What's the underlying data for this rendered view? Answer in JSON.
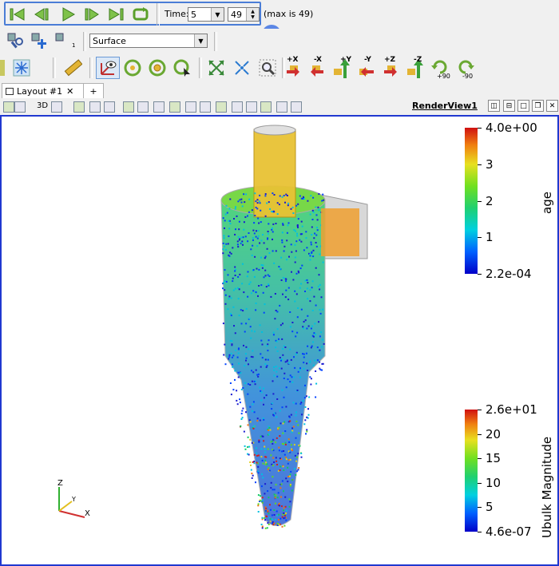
{
  "toolbar_time": {
    "time_label": "Time:",
    "time_value": "5",
    "index_value": "49",
    "max_text": "(max is 49)",
    "badge": "1"
  },
  "toolbar_representation": {
    "value": "Surface",
    "step_label": "1"
  },
  "camera": {
    "plus_x": "+X",
    "minus_x": "-X",
    "plus_y": "+Y",
    "minus_y": "-Y",
    "plus_z": "+Z",
    "minus_z": "-Z",
    "rot_pos": "+90",
    "rot_neg": "-90"
  },
  "tabs": {
    "layout": "Layout #1",
    "add": "+"
  },
  "viewbar": {
    "mode_3d": "3D",
    "render_view": "RenderView1"
  },
  "colorbar_age": {
    "title": "age",
    "ticks": [
      "4.0e+00",
      "3",
      "2",
      "1",
      "2.2e-04"
    ],
    "range": [
      0.00022,
      4.0
    ]
  },
  "colorbar_u": {
    "title": "Ubulk Magnitude",
    "ticks": [
      "2.6e+01",
      "20",
      "15",
      "10",
      "5",
      "4.6e-07"
    ],
    "range": [
      4.6e-07,
      26
    ]
  },
  "axes": {
    "x": "X",
    "y": "Y",
    "z": "Z"
  }
}
